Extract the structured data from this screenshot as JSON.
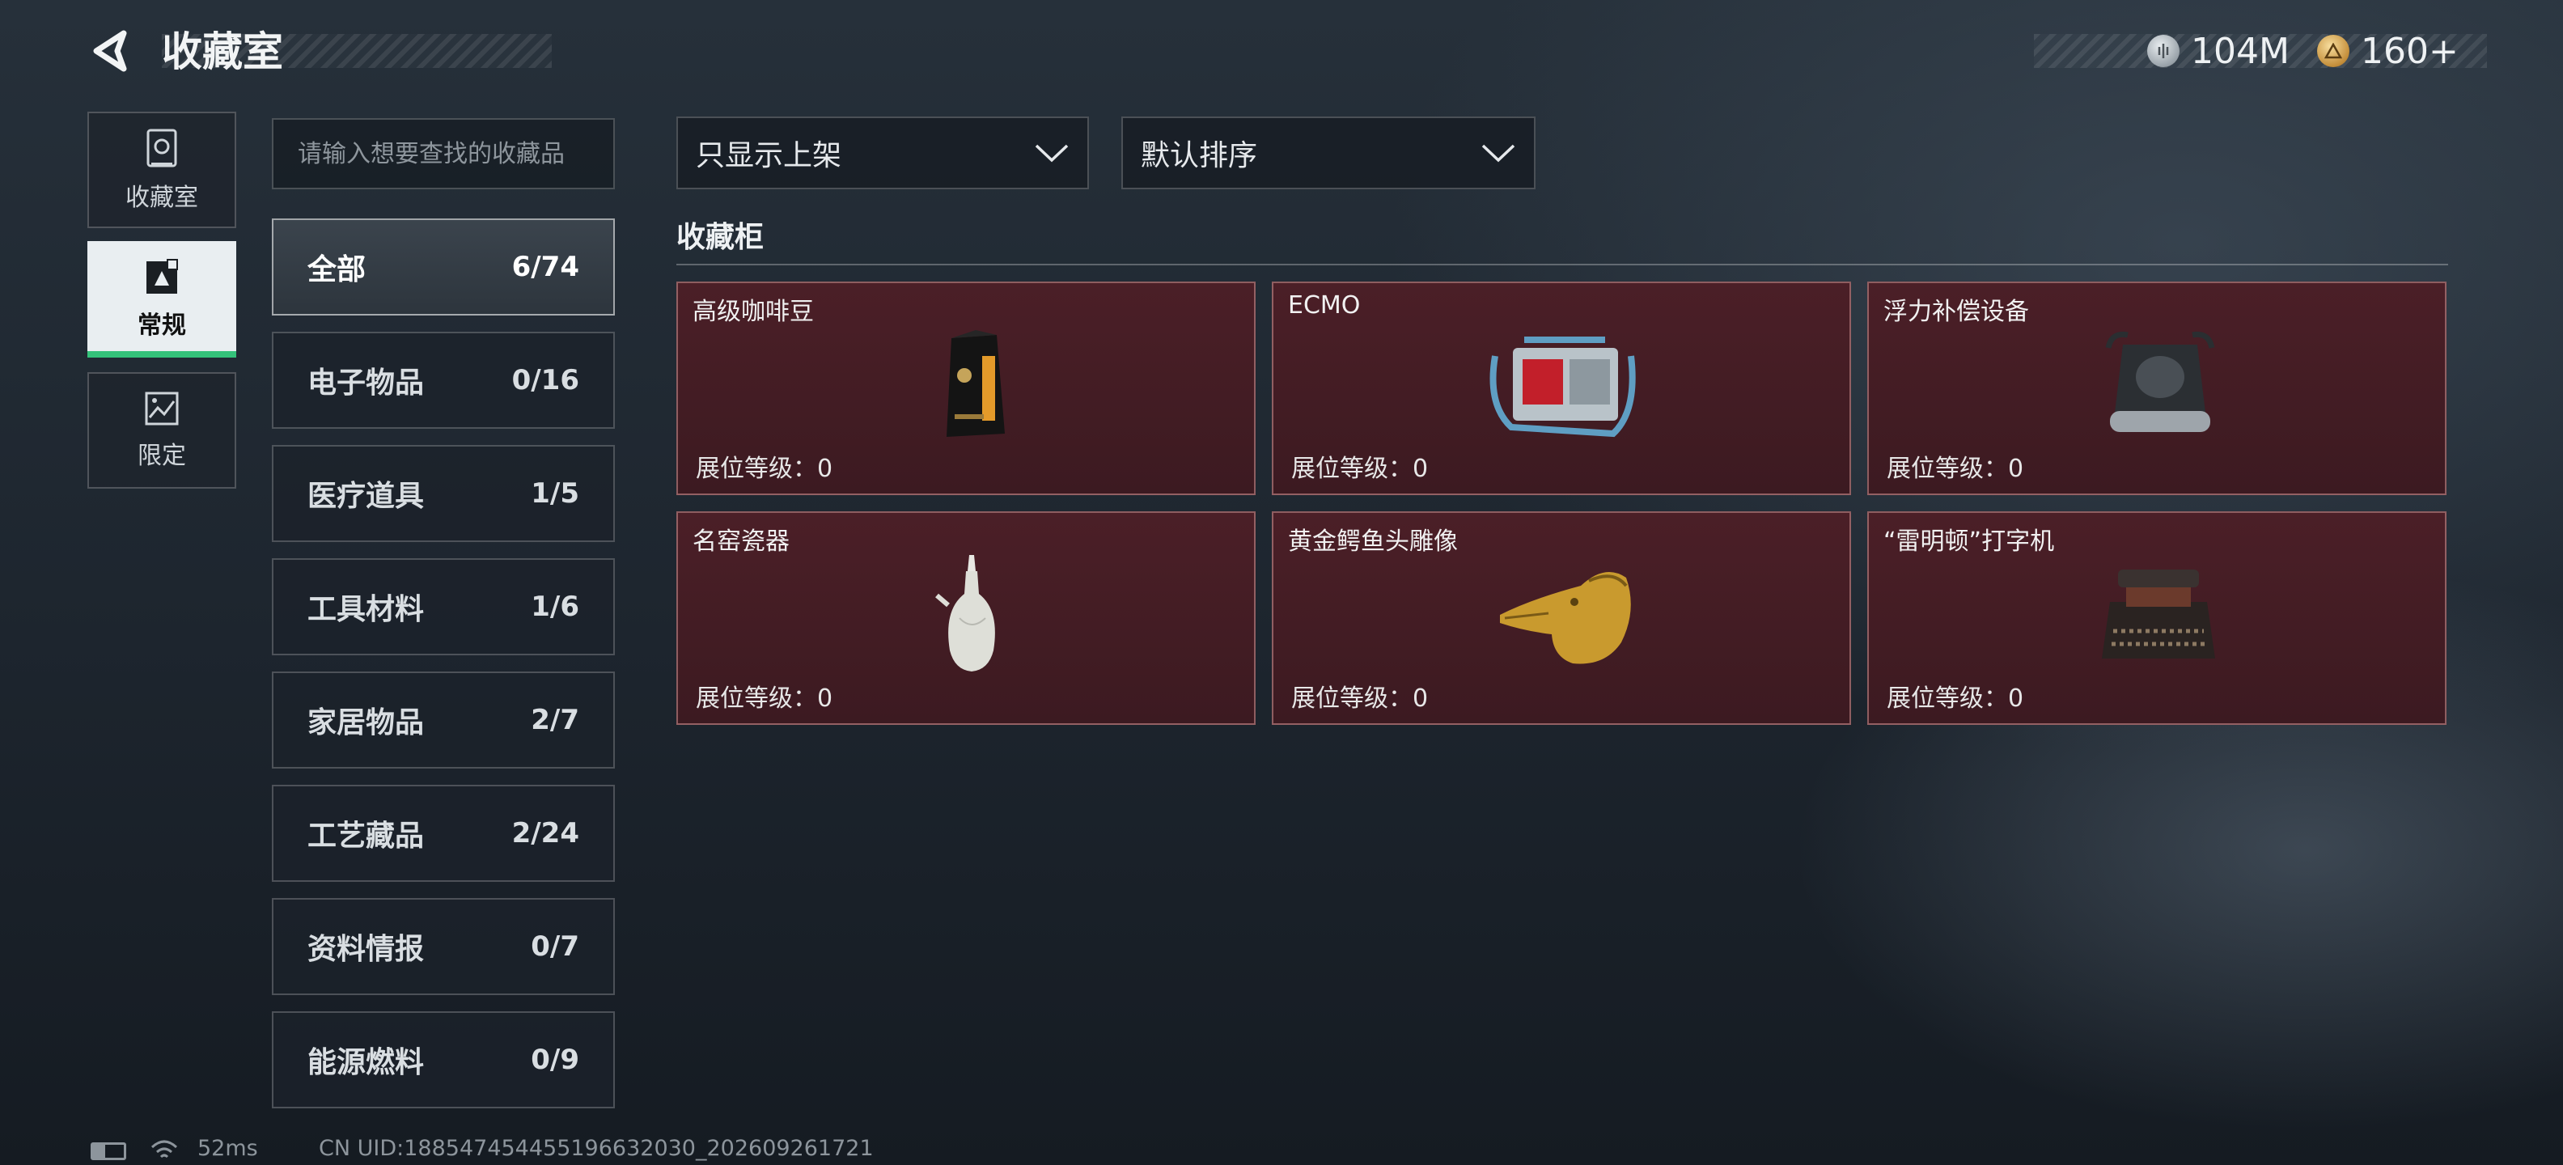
{
  "header": {
    "title": "收藏室"
  },
  "currency": [
    {
      "icon": "silver-coin-icon",
      "value": "104M",
      "color": "#c9cfd4"
    },
    {
      "icon": "gold-coin-icon",
      "value": "160+",
      "color": "#d6a85a"
    }
  ],
  "nav": [
    {
      "label": "收藏室",
      "icon": "vault-icon",
      "active": false
    },
    {
      "label": "常规",
      "icon": "exhibit-icon",
      "active": true
    },
    {
      "label": "限定",
      "icon": "limited-icon",
      "active": false
    }
  ],
  "search": {
    "placeholder": "请输入想要查找的收藏品"
  },
  "categories": [
    {
      "name": "全部",
      "count": "6/74"
    },
    {
      "name": "电子物品",
      "count": "0/16"
    },
    {
      "name": "医疗道具",
      "count": "1/5"
    },
    {
      "name": "工具材料",
      "count": "1/6"
    },
    {
      "name": "家居物品",
      "count": "2/7"
    },
    {
      "name": "工艺藏品",
      "count": "2/24"
    },
    {
      "name": "资料情报",
      "count": "0/7"
    },
    {
      "name": "能源燃料",
      "count": "0/9"
    }
  ],
  "filters": {
    "display": "只显示上架",
    "sort": "默认排序"
  },
  "section": {
    "title": "收藏柜"
  },
  "items": [
    {
      "name": "高级咖啡豆",
      "level": "展位等级：0",
      "icon": "coffee-bag-icon"
    },
    {
      "name": "ECMO",
      "level": "展位等级：0",
      "icon": "ecmo-machine-icon"
    },
    {
      "name": "浮力补偿设备",
      "level": "展位等级：0",
      "icon": "bcd-vest-icon"
    },
    {
      "name": "名窑瓷器",
      "level": "展位等级：0",
      "icon": "porcelain-vase-icon"
    },
    {
      "name": "黄金鳄鱼头雕像",
      "level": "展位等级：0",
      "icon": "golden-crocodile-icon"
    },
    {
      "name": "“雷明顿”打字机",
      "level": "展位等级：0",
      "icon": "typewriter-icon"
    }
  ],
  "status": {
    "ping": "52ms",
    "uid": "CN UID:1885474544551966320​30_202609261721"
  }
}
